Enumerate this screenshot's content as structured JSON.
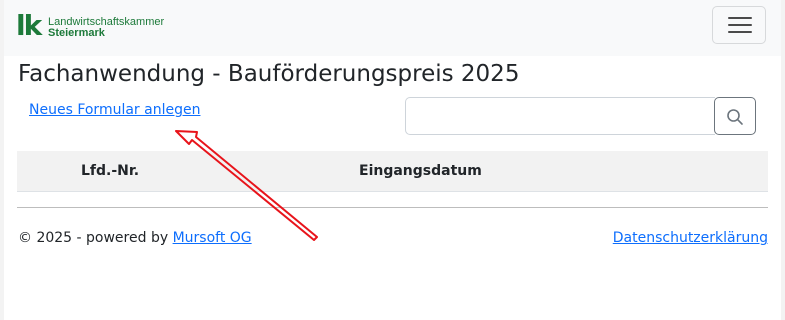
{
  "brand": {
    "mark": "lk",
    "line1": "Landwirtschaftskammer",
    "line2": "Steiermark",
    "color": "#1d7a3a"
  },
  "navbar": {
    "toggler_icon": "hamburger-icon"
  },
  "page": {
    "title": "Fachanwendung - Bauförderungspreis 2025"
  },
  "actions": {
    "new_form_label": "Neues Formular anlegen"
  },
  "search": {
    "value": "",
    "placeholder": "",
    "icon": "search-icon"
  },
  "table": {
    "columns": [
      "Lfd.-Nr.",
      "Eingangsdatum"
    ],
    "rows": []
  },
  "footer": {
    "copyright": "© 2025 - powered by",
    "company_link": "Mursoft OG",
    "privacy_link": "Datenschutzerklärung"
  },
  "annotation": {
    "type": "arrow",
    "color": "#e8141b"
  },
  "colors": {
    "link": "#0d6efd",
    "navbar_bg": "#f8f9fa",
    "table_head_bg": "#f2f2f2"
  }
}
